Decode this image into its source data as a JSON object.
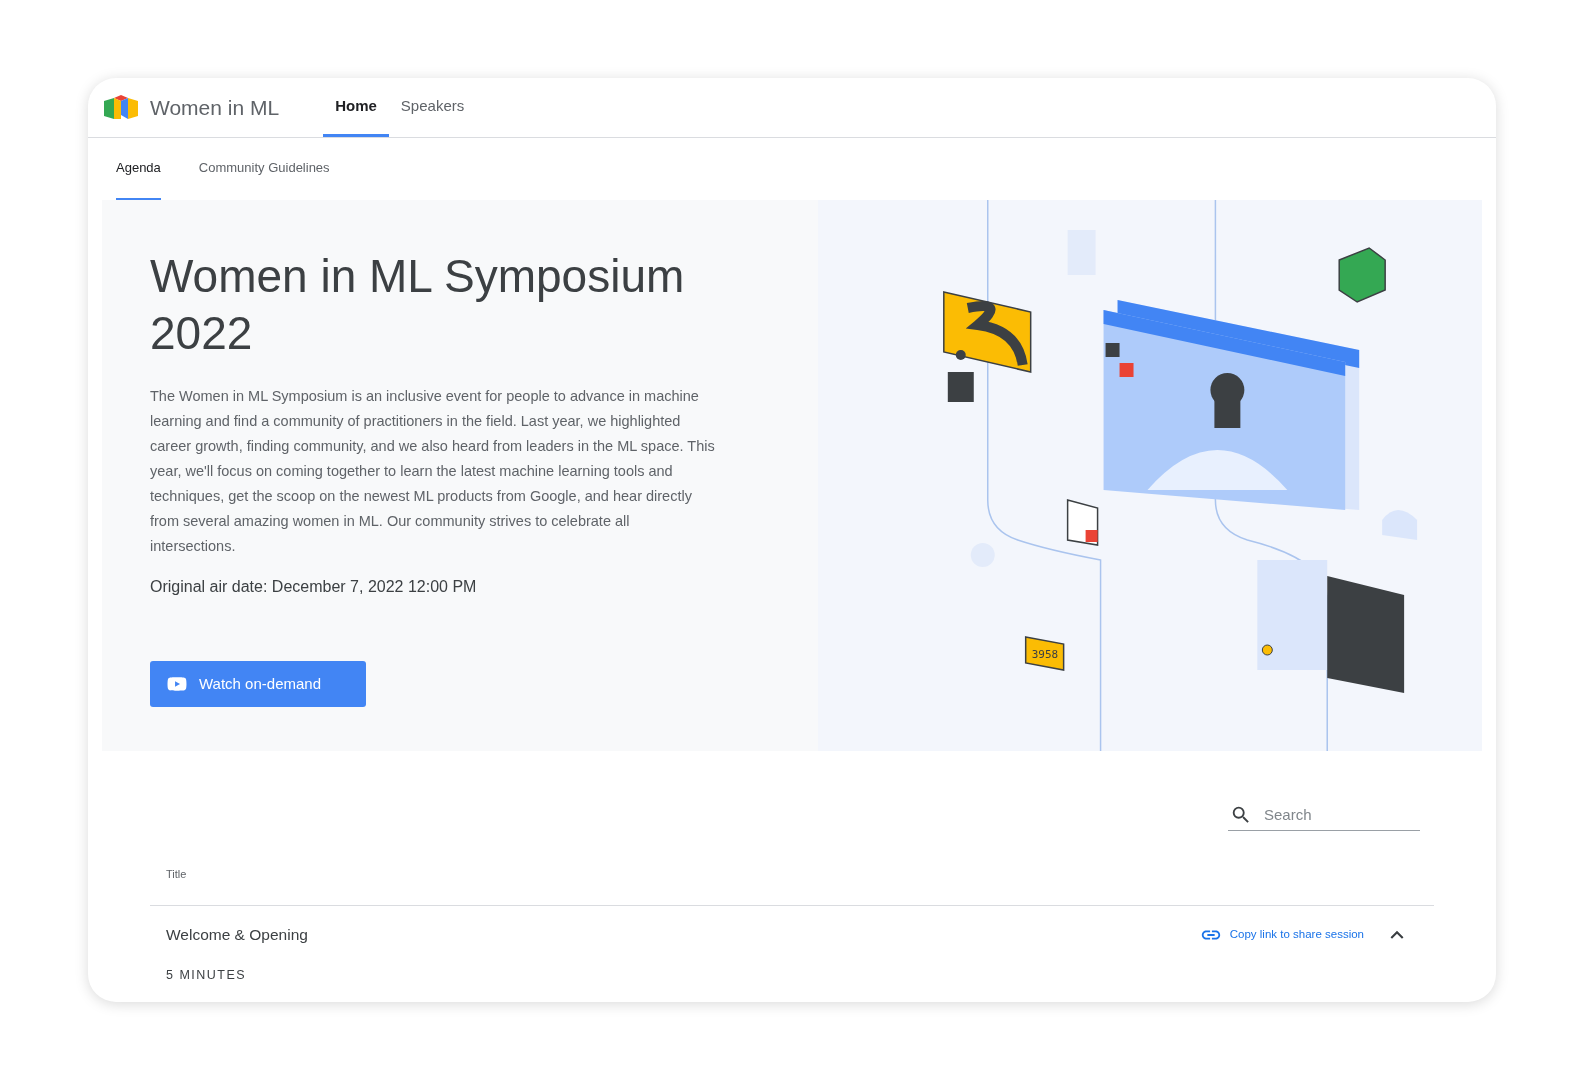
{
  "site": {
    "title": "Women in ML"
  },
  "nav": [
    {
      "label": "Home",
      "selected": true
    },
    {
      "label": "Speakers",
      "selected": false
    }
  ],
  "subtabs": [
    {
      "label": "Agenda",
      "selected": true
    },
    {
      "label": "Community Guidelines",
      "selected": false
    }
  ],
  "hero": {
    "title": "Women in ML Symposium 2022",
    "description": "The Women in ML Symposium is an inclusive event for people to advance in machine learning and find a community of practitioners in the field. Last year, we highlighted career growth, finding community, and we also heard from leaders in the ML space. This year, we'll focus on coming together to learn the latest machine learning tools and techniques, get the scoop on the newest ML products from Google, and hear directly from several amazing women in ML. Our community strives to celebrate all intersections.",
    "air_date": "Original air date: December 7, 2022 12:00 PM",
    "button": "Watch on-demand",
    "illustration_label": "3958"
  },
  "search": {
    "placeholder": "Search"
  },
  "agenda": {
    "column": "Title",
    "sessions": [
      {
        "title": "Welcome & Opening",
        "link": "Copy link to share session",
        "expanded": true,
        "duration": "5 MINUTES"
      }
    ]
  }
}
